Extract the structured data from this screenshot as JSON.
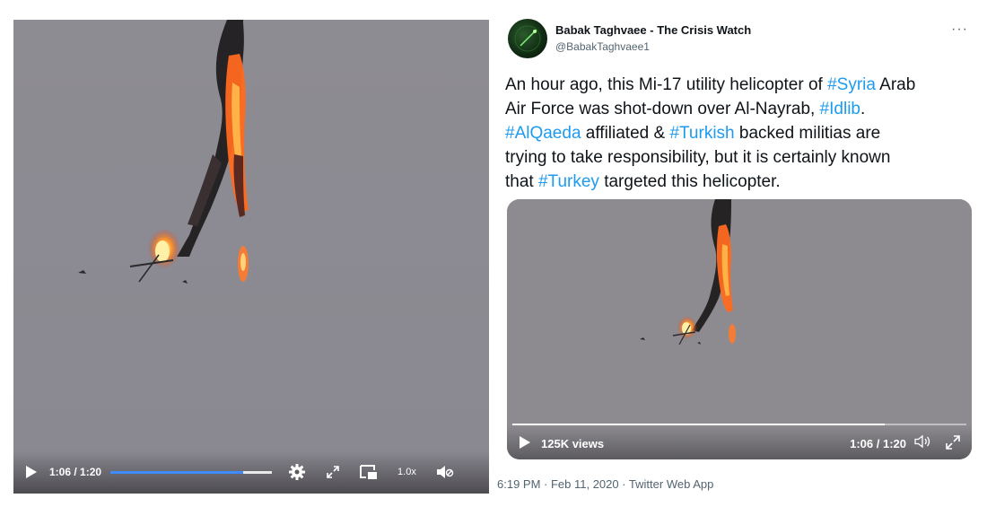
{
  "left_player": {
    "time": "1:06 / 1:20",
    "progress": 0.82,
    "speed": "1.0x",
    "icons": [
      "play-icon",
      "settings-gear-icon",
      "expand-icon",
      "picture-in-picture-icon",
      "mute-icon"
    ]
  },
  "tweet": {
    "display_name": "Babak Taghvaee - The Crisis Watch",
    "handle": "@BabakTaghvaee1",
    "more": "···",
    "text": {
      "l1_a": "An hour ago, this Mi-17 utility helicopter of ",
      "l1_tag": "#Syria",
      "l1_b": " Arab",
      "l2_a": "Air Force was shot-down over Al-Nayrab, ",
      "l2_tag": "#Idlib",
      "l2_b": ".",
      "l3_tag1": "#AlQaeda",
      "l3_a": " affiliated & ",
      "l3_tag2": "#Turkish",
      "l3_b": " backed militias are",
      "l4": "trying to take responsibility, but it is certainly known",
      "l5_a": "that ",
      "l5_tag": "#Turkey",
      "l5_b": " targeted this helicopter."
    },
    "video": {
      "views": "125K views",
      "time": "1:06 / 1:20",
      "progress": 0.82
    },
    "meta": "6:19 PM · Feb 11, 2020 · Twitter Web App"
  },
  "colors": {
    "hashtag": "#1d9bf0",
    "left_progress": "#3d8bff",
    "sky": "#8f8d93"
  }
}
